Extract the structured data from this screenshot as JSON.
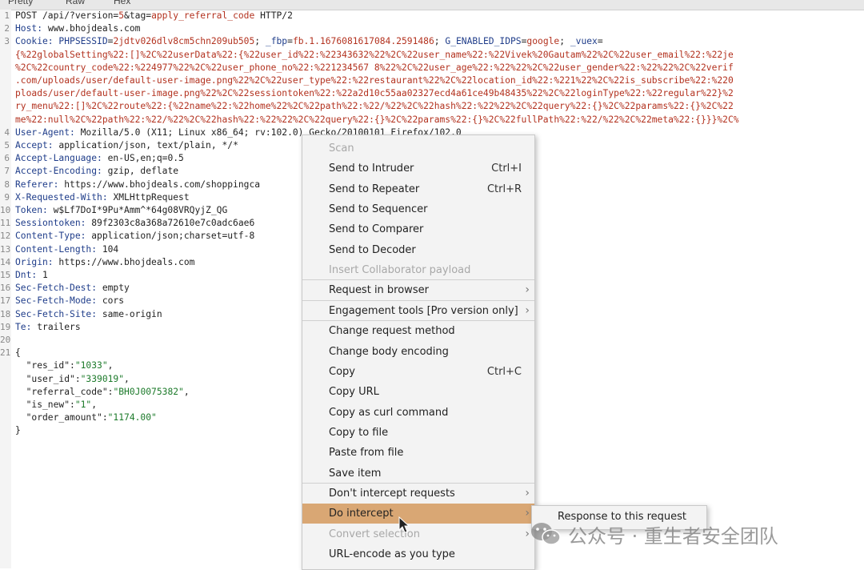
{
  "tabs": [
    "Pretty",
    "Raw",
    "Hex"
  ],
  "request_lines": [
    {
      "n": "1",
      "segs": [
        {
          "t": "POST /api/?version=",
          "c": "hv"
        },
        {
          "t": "5",
          "c": "red"
        },
        {
          "t": "&tag=",
          "c": "hv"
        },
        {
          "t": "apply_referral_code",
          "c": "red"
        },
        {
          "t": " HTTP/2",
          "c": "hv"
        }
      ]
    },
    {
      "n": "2",
      "segs": [
        {
          "t": "Host: ",
          "c": "hk"
        },
        {
          "t": "www.bhojdeals.com",
          "c": "hv"
        }
      ]
    },
    {
      "n": "3",
      "segs": [
        {
          "t": "Cookie: ",
          "c": "hk"
        },
        {
          "t": "PHPSESSID",
          "c": "hk"
        },
        {
          "t": "=",
          "c": "hv"
        },
        {
          "t": "2jdtv026dlv8cm5chn209ub505",
          "c": "red"
        },
        {
          "t": "; ",
          "c": "hv"
        },
        {
          "t": "_fbp",
          "c": "hk"
        },
        {
          "t": "=",
          "c": "hv"
        },
        {
          "t": "fb.1.1676081617084.2591486",
          "c": "red"
        },
        {
          "t": "; ",
          "c": "hv"
        },
        {
          "t": "G_ENABLED_IDPS",
          "c": "hk"
        },
        {
          "t": "=",
          "c": "hv"
        },
        {
          "t": "google",
          "c": "red"
        },
        {
          "t": "; ",
          "c": "hv"
        },
        {
          "t": "_vuex",
          "c": "hk"
        },
        {
          "t": "=",
          "c": "hv"
        }
      ]
    },
    {
      "n": "",
      "segs": [
        {
          "t": "{%22globalSetting%22:[]%2C%22userData%22:{%22user_id%22:%22343632%22%2C%22user_name%22:%22Vivek%20Gautam%22%2C%22user_email%22:%22je",
          "c": "red"
        }
      ]
    },
    {
      "n": "",
      "segs": [
        {
          "t": "%2C%22country_code%22:%224977%22%2C%22user_phone_no%22:%221234567 8%22%2C%22user_age%22:%22%22%2C%22user_gender%22:%22%22%2C%22verif",
          "c": "red"
        }
      ]
    },
    {
      "n": "",
      "segs": [
        {
          "t": ".com/uploads/user/default-user-image.png%22%2C%22user_type%22:%22restaurant%22%2C%22location_id%22:%221%22%2C%22is_subscribe%22:%220",
          "c": "red"
        }
      ]
    },
    {
      "n": "",
      "segs": [
        {
          "t": "ploads/user/default-user-image.png%22%2C%22sessiontoken%22:%22a2d10c55aa02327ecd4a61ce49b48435%22%2C%22loginType%22:%22regular%22}%2",
          "c": "red"
        }
      ]
    },
    {
      "n": "",
      "segs": [
        {
          "t": "ry_menu%22:[]%2C%22route%22:{%22name%22:%22home%22%2C%22path%22:%22/%22%2C%22hash%22:%22%22%2C%22query%22:{}%2C%22params%22:{}%2C%22",
          "c": "red"
        }
      ]
    },
    {
      "n": "",
      "segs": [
        {
          "t": "me%22:null%2C%22path%22:%22/%22%2C%22hash%22:%22%22%2C%22query%22:{}%2C%22params%22:{}%2C%22fullPath%22:%22/%22%2C%22meta%22:{}}}%2C%",
          "c": "red"
        }
      ]
    },
    {
      "n": "4",
      "segs": [
        {
          "t": "User-Agent: ",
          "c": "hk"
        },
        {
          "t": "Mozilla/5.0 (X11; Linux x86_64; rv:102.0) Gecko/20100101 Firefox/102.0",
          "c": "hv"
        }
      ]
    },
    {
      "n": "5",
      "segs": [
        {
          "t": "Accept: ",
          "c": "hk"
        },
        {
          "t": "application/json, text/plain, */*",
          "c": "hv"
        }
      ]
    },
    {
      "n": "6",
      "segs": [
        {
          "t": "Accept-Language: ",
          "c": "hk"
        },
        {
          "t": "en-US,en;q=0.5",
          "c": "hv"
        }
      ]
    },
    {
      "n": "7",
      "segs": [
        {
          "t": "Accept-Encoding: ",
          "c": "hk"
        },
        {
          "t": "gzip, deflate",
          "c": "hv"
        }
      ]
    },
    {
      "n": "8",
      "segs": [
        {
          "t": "Referer: ",
          "c": "hk"
        },
        {
          "t": "https://www.bhojdeals.com/shoppingca",
          "c": "hv"
        }
      ]
    },
    {
      "n": "9",
      "segs": [
        {
          "t": "X-Requested-With: ",
          "c": "hk"
        },
        {
          "t": "XMLHttpRequest",
          "c": "hv"
        }
      ]
    },
    {
      "n": "10",
      "segs": [
        {
          "t": "Token: ",
          "c": "hk"
        },
        {
          "t": "w$Lf7DoI*9Pu*Amm^*64g08VRQyjZ_QG",
          "c": "hv"
        }
      ]
    },
    {
      "n": "11",
      "segs": [
        {
          "t": "Sessiontoken: ",
          "c": "hk"
        },
        {
          "t": "89f2303c8a368a72610e7c0adc6ae6",
          "c": "hv"
        }
      ]
    },
    {
      "n": "12",
      "segs": [
        {
          "t": "Content-Type: ",
          "c": "hk"
        },
        {
          "t": "application/json;charset=utf-8",
          "c": "hv"
        }
      ]
    },
    {
      "n": "13",
      "segs": [
        {
          "t": "Content-Length: ",
          "c": "hk"
        },
        {
          "t": "104",
          "c": "hv"
        }
      ]
    },
    {
      "n": "14",
      "segs": [
        {
          "t": "Origin: ",
          "c": "hk"
        },
        {
          "t": "https://www.bhojdeals.com",
          "c": "hv"
        }
      ]
    },
    {
      "n": "15",
      "segs": [
        {
          "t": "Dnt: ",
          "c": "hk"
        },
        {
          "t": "1",
          "c": "hv"
        }
      ]
    },
    {
      "n": "16",
      "segs": [
        {
          "t": "Sec-Fetch-Dest: ",
          "c": "hk"
        },
        {
          "t": "empty",
          "c": "hv"
        }
      ]
    },
    {
      "n": "17",
      "segs": [
        {
          "t": "Sec-Fetch-Mode: ",
          "c": "hk"
        },
        {
          "t": "cors",
          "c": "hv"
        }
      ]
    },
    {
      "n": "18",
      "segs": [
        {
          "t": "Sec-Fetch-Site: ",
          "c": "hk"
        },
        {
          "t": "same-origin",
          "c": "hv"
        }
      ]
    },
    {
      "n": "19",
      "segs": [
        {
          "t": "Te: ",
          "c": "hk"
        },
        {
          "t": "trailers",
          "c": "hv"
        }
      ]
    },
    {
      "n": "20",
      "segs": []
    },
    {
      "n": "21",
      "segs": [
        {
          "t": "{",
          "c": "hv"
        }
      ]
    },
    {
      "n": "",
      "segs": [
        {
          "t": "  \"res_id\":",
          "c": "jk"
        },
        {
          "t": "\"1033\"",
          "c": "js"
        },
        {
          "t": ",",
          "c": "hv"
        }
      ]
    },
    {
      "n": "",
      "segs": [
        {
          "t": "  \"user_id\":",
          "c": "jk"
        },
        {
          "t": "\"339019\"",
          "c": "js"
        },
        {
          "t": ",",
          "c": "hv"
        }
      ]
    },
    {
      "n": "",
      "segs": [
        {
          "t": "  \"referral_code\":",
          "c": "jk"
        },
        {
          "t": "\"BH0J0075382\"",
          "c": "js"
        },
        {
          "t": ",",
          "c": "hv"
        }
      ]
    },
    {
      "n": "",
      "segs": [
        {
          "t": "  \"is_new\":",
          "c": "jk"
        },
        {
          "t": "\"1\"",
          "c": "js"
        },
        {
          "t": ",",
          "c": "hv"
        }
      ]
    },
    {
      "n": "",
      "segs": [
        {
          "t": "  \"order_amount\":",
          "c": "jk"
        },
        {
          "t": "\"1174.00\"",
          "c": "js"
        }
      ]
    },
    {
      "n": "",
      "segs": [
        {
          "t": "}",
          "c": "hv"
        }
      ]
    }
  ],
  "context_menu": {
    "items": [
      {
        "label": "Scan",
        "disabled": true
      },
      {
        "label": "Send to Intruder",
        "shortcut": "Ctrl+I"
      },
      {
        "label": "Send to Repeater",
        "shortcut": "Ctrl+R"
      },
      {
        "label": "Send to Sequencer"
      },
      {
        "label": "Send to Comparer"
      },
      {
        "label": "Send to Decoder"
      },
      {
        "label": "Insert Collaborator payload",
        "disabled": true
      },
      {
        "label": "Request in browser",
        "submenu": true
      },
      {
        "label": "Engagement tools [Pro version only]",
        "submenu": true
      },
      {
        "label": "Change request method"
      },
      {
        "label": "Change body encoding"
      },
      {
        "label": "Copy",
        "shortcut": "Ctrl+C"
      },
      {
        "label": "Copy URL"
      },
      {
        "label": "Copy as curl command"
      },
      {
        "label": "Copy to file"
      },
      {
        "label": "Paste from file"
      },
      {
        "label": "Save item"
      },
      {
        "label": "Don't intercept requests",
        "submenu": true
      },
      {
        "label": "Do intercept",
        "submenu": true,
        "highlighted": true
      },
      {
        "label": "Convert selection",
        "submenu": true,
        "disabled": true
      },
      {
        "label": "URL-encode as you type"
      }
    ],
    "submenu_arrow": "›"
  },
  "submenu": {
    "label": "Response to this request"
  },
  "watermark": {
    "text": "公众号 · 重生者安全团队"
  },
  "colors": {
    "highlight": "#d9a774",
    "header_key": "#1f3d8a",
    "param_value": "#b3321f",
    "json_string": "#1c7a2a"
  }
}
